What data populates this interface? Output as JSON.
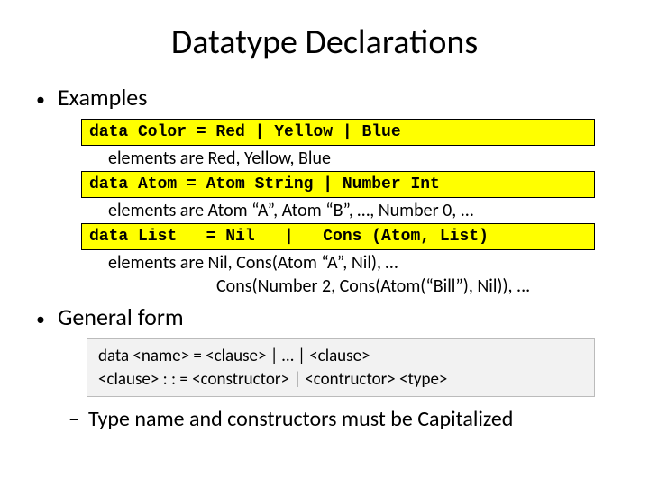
{
  "title": "Datatype Declarations",
  "examples": {
    "heading": "Examples",
    "code1": "data Color = Red | Yellow | Blue",
    "desc1": "elements are Red, Yellow, Blue",
    "code2": "data Atom = Atom String | Number Int",
    "desc2": "elements are Atom “A”, Atom “B”, …, Number 0, ...",
    "code3": "data List   = Nil   |   Cons (Atom, List)",
    "desc3a": "elements are Nil, Cons(Atom “A”, Nil), …",
    "desc3b": "Cons(Number 2, Cons(Atom(“Bill”), Nil)), ..."
  },
  "general": {
    "heading": "General form",
    "line1": "data <name> = <clause> | … | <clause>",
    "line2": "<clause> : : = <constructor> | <contructor> <type>",
    "note": "Type name and constructors must be Capitalized"
  }
}
